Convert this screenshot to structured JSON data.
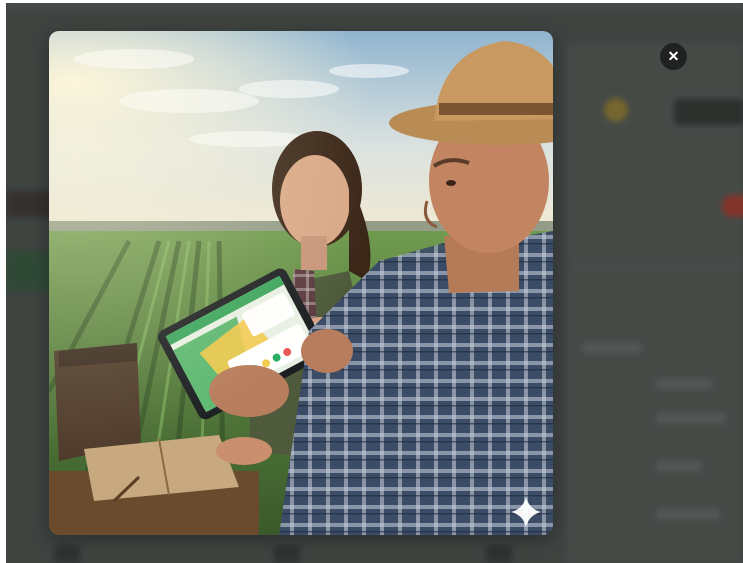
{
  "overlay": {
    "close_icon_glyph": "✕",
    "backdrop_color": "#3f4441",
    "close_button_color": "#202222"
  },
  "image": {
    "watermark_icon": "sparkle-icon"
  }
}
